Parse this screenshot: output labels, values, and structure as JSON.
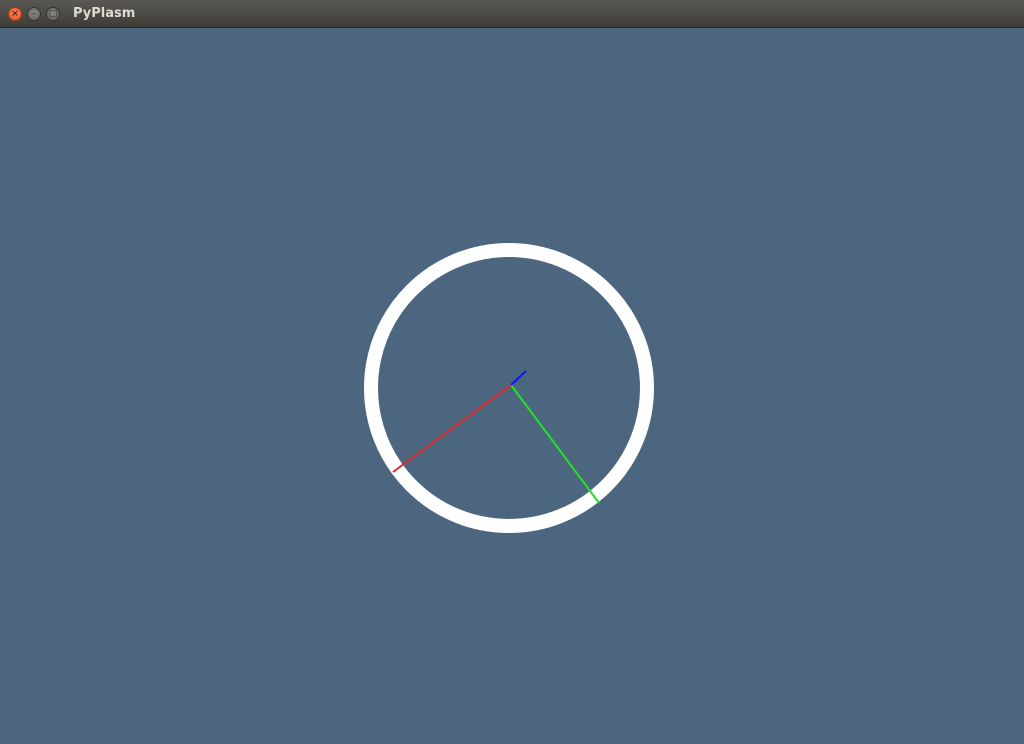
{
  "window": {
    "title": "PyPlasm",
    "controls": {
      "close_icon": "close-icon",
      "minimize_icon": "minimize-icon",
      "maximize_icon": "maximize-icon"
    }
  },
  "viewport": {
    "background_color": "#4d6680",
    "ring_color": "#ffffff",
    "axes": {
      "x_color": "#e02a2a",
      "y_color": "#22e022",
      "z_color": "#1010ff"
    }
  }
}
